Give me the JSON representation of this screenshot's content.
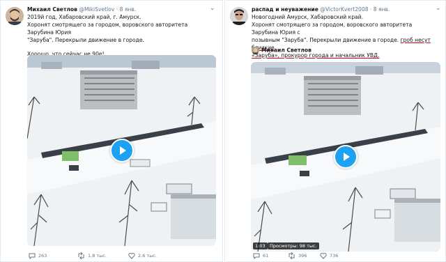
{
  "tweets": [
    {
      "author": "Михаил Светлов",
      "handle": "@MikiSvetlov",
      "date": "· 8 янв.",
      "lines": [
        "2019й год, Хабаровский край, г. Амурск.",
        "Хоронят смотрящего за городом, воровского авторитета Зарубина Юрия",
        "\"Заруба\". Перекрыли движение в городе.",
        "Хорошо, что сейчас не 90е!"
      ],
      "stats": {
        "replies": "263",
        "retweets": "1,8 тыс.",
        "likes": "2,6 тыс."
      }
    },
    {
      "author": "распад и неуважение",
      "handle": "@VictorKvert2008",
      "date": "· 8 янв.",
      "lines": [
        "Новогодний Амурск, Хабаровский край.",
        "Хоронят смотрящего за городом, воровского авторитета Зарубина Юрия с",
        "позывным \"Заруба\". Перекрыли движение в городе.",
        "гроб несут близкие",
        "«Заруба», прокурор города и начальник УВД."
      ],
      "quoted_author": "Михаил Светлов",
      "video_time": "1:03",
      "video_views": "Просмотры: 98 тыс.",
      "stats": {
        "replies": "61",
        "retweets": "396",
        "likes": "736"
      }
    }
  ],
  "colors": {
    "play": "#1da1f2",
    "underline": "#d0021b",
    "meta": "#657786"
  }
}
